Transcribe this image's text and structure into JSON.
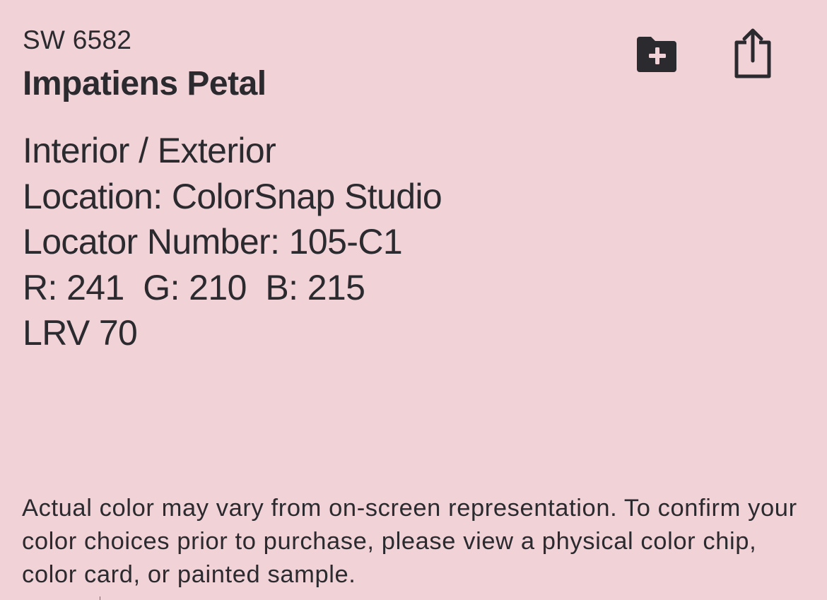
{
  "color": {
    "code": "SW 6582",
    "name": "Impatiens Petal",
    "swatch_hex": "#f1d2d7",
    "text_color": "#2b2b2f"
  },
  "actions": {
    "add_to_folder_icon": "folder-plus-icon",
    "share_icon": "share-icon"
  },
  "details": {
    "usage": "Interior / Exterior",
    "location": "Location: ColorSnap Studio",
    "locator_number": "Locator Number: 105-C1",
    "rgb": "R: 241  G: 210  B: 215",
    "lrv": "LRV 70"
  },
  "disclaimer": "Actual color may vary from on-screen representation. To confirm your color choices prior to purchase, please view a physical color chip, color card, or painted sample."
}
